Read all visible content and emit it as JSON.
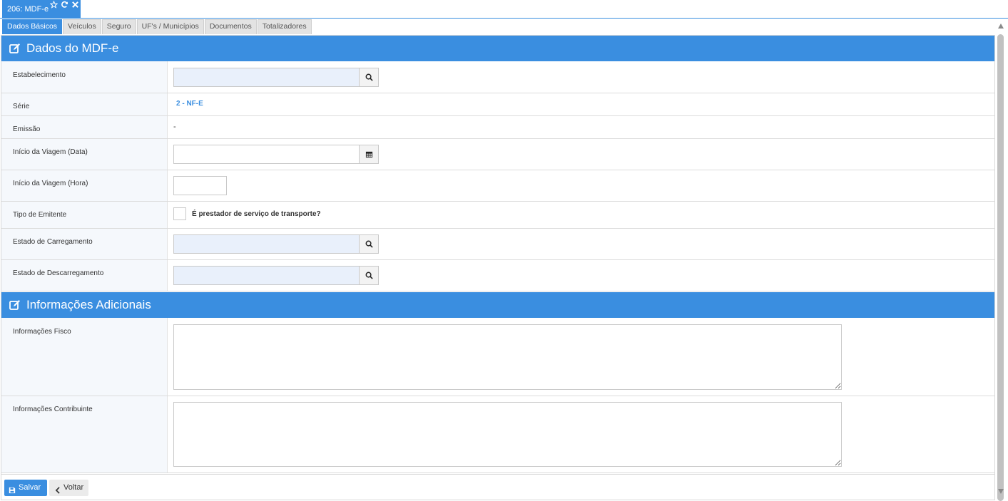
{
  "window_tab": {
    "title": "206: MDF-e",
    "icons": [
      "star-icon",
      "refresh-icon",
      "close-icon"
    ]
  },
  "form_tabs": [
    "Dados Básicos",
    "Veículos",
    "Seguro",
    "UF's / Municípios",
    "Documentos",
    "Totalizadores"
  ],
  "sections": {
    "dados": {
      "title": "Dados do MDF-e",
      "icon": "edit-icon"
    },
    "info": {
      "title": "Informações Adicionais",
      "icon": "edit-icon"
    }
  },
  "fields": {
    "estabelecimento": {
      "label": "Estabelecimento",
      "value": ""
    },
    "serie": {
      "label": "Série",
      "value": "2 - NF-E"
    },
    "emissao": {
      "label": "Emissão",
      "value": "-"
    },
    "inicio_data": {
      "label": "Início da Viagem (Data)",
      "value": ""
    },
    "inicio_hora": {
      "label": "Início da Viagem (Hora)",
      "value": ""
    },
    "tipo_emitente": {
      "label": "Tipo de Emitente",
      "checkbox_label": "É prestador de serviço de transporte?",
      "checked": false
    },
    "estado_carregamento": {
      "label": "Estado de Carregamento",
      "value": ""
    },
    "estado_descarregamento": {
      "label": "Estado de Descarregamento",
      "value": ""
    },
    "info_fisco": {
      "label": "Informações Fisco",
      "value": ""
    },
    "info_contribuinte": {
      "label": "Informações Contribuinte",
      "value": ""
    }
  },
  "footer": {
    "save_label": "Salvar",
    "back_label": "Voltar"
  },
  "colors": {
    "accent": "#3a8ee0",
    "lookup_bg": "#e9f0fb",
    "label_bg": "#f5f8fc"
  }
}
